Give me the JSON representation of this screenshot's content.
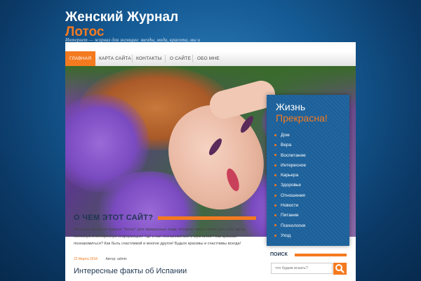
{
  "site": {
    "title_line1": "Женский Журнал",
    "title_line2": "Лотос",
    "tagline": "Интернет — журнал для женщин: звезды, мода, красота, мы и"
  },
  "nav": {
    "items": [
      "ГЛАВНАЯ",
      "КАРТА САЙТА",
      "КОНТАКТЫ",
      "О САЙТЕ",
      "ОБО МНЕ"
    ],
    "active_index": 0
  },
  "slider": {
    "slide_count": 2,
    "promo": {
      "title_line1": "Жизнь",
      "title_line2": "Прекрасна!",
      "items": [
        "Дом",
        "Вера",
        "Воспитание",
        "Интересное",
        "Карьера",
        "Здоровье",
        "Отношения",
        "Новости",
        "Питание",
        "Психология",
        "Уход"
      ]
    }
  },
  "about": {
    "heading": "О ЧЕМ ЭТОТ САЙТ?",
    "text": "Женский интернет журнал \"Лотос\" для прекрасных леди, которые смогу найти для себя здесь полезную и интересную информацию! Где и как познакомиться с мужчиной? Как красиво познакомиться? Как быть счастливой и многое другое! Будьте красивы и счастливы всегда!"
  },
  "post": {
    "date": "22 Марта 2016",
    "author": "Автор: admin",
    "title": "Интересные факты об Испании"
  },
  "search": {
    "heading": "ПОИСК",
    "placeholder": "что будем искать?"
  },
  "colors": {
    "accent": "#f47a20",
    "background": "#155b95",
    "heading": "#1f3550"
  },
  "icons": {
    "search_button": "search-icon"
  }
}
